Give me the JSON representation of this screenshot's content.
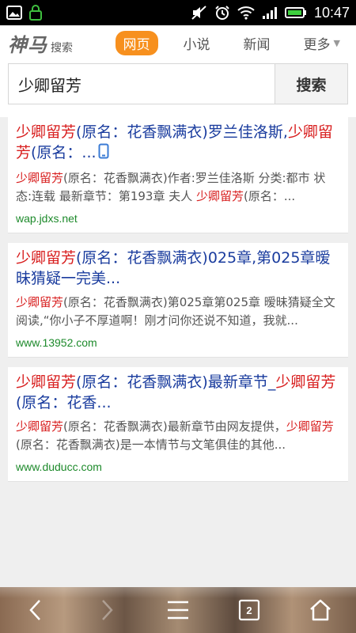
{
  "status_bar": {
    "time": "10:47"
  },
  "header": {
    "logo_main": "神马",
    "logo_sub": "搜索",
    "tabs": [
      {
        "label": "网页",
        "active": true
      },
      {
        "label": "小说",
        "active": false
      },
      {
        "label": "新闻",
        "active": false
      },
      {
        "label": "更多",
        "active": false
      }
    ]
  },
  "search": {
    "query": "少卿留芳",
    "button_label": "搜索"
  },
  "results": [
    {
      "title_hl_1": "少卿留芳",
      "title_1": "(原名：花香飘满衣)罗兰佳洛斯,",
      "title_hl_2": "少卿留芳",
      "title_2": "(原名：...",
      "snippet_hl_1": "少卿留芳",
      "snippet_1": "(原名：花香飘满衣)作者:罗兰佳洛斯 分类:都市 状态:连载 最新章节：第193章 夫人 ",
      "snippet_hl_2": "少卿留芳",
      "snippet_2": "(原名：...",
      "url": "wap.jdxs.net"
    },
    {
      "title_hl_1": "少卿留芳",
      "title_1": "(原名：花香飘满衣)025章,第025章暧昧猜疑一完美...",
      "snippet_hl_1": "少卿留芳",
      "snippet_1": "(原名：花香飘满衣)第025章第025章 暧昧猜疑全文阅读,“你小子不厚道啊！刚才问你还说不知道，我就...",
      "url": "www.13952.com"
    },
    {
      "title_hl_1": "少卿留芳",
      "title_1": "(原名：花香飘满衣)最新章节_",
      "title_hl_2": "少卿留芳",
      "title_2": "(原名：花香...",
      "snippet_hl_1": "少卿留芳",
      "snippet_1": "(原名：花香飘满衣)最新章节由网友提供，",
      "snippet_hl_2": "少卿留芳",
      "snippet_2": "(原名：花香飘满衣)是一本情节与文笔俱佳的其他...",
      "url": "www.duducc.com"
    }
  ],
  "toolbar": {
    "tab_count": "2"
  },
  "colors": {
    "accent": "#f7901e",
    "link": "#1a3c9e",
    "highlight": "#d81e1e",
    "url": "#1d8a2b"
  }
}
